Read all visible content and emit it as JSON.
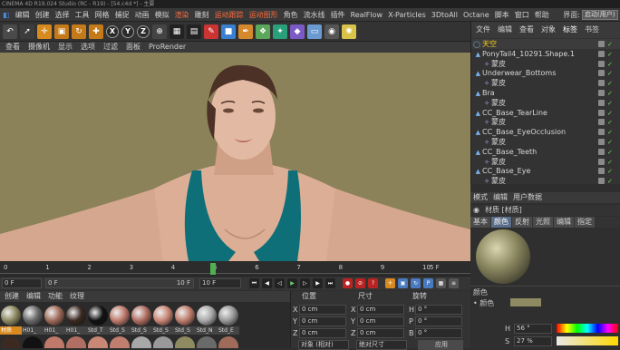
{
  "window": {
    "title": "CINEMA 4D R19.024 Studio (RC - R19) - [54.c4d *] - 主要"
  },
  "menubar": {
    "items": [
      "编辑",
      "创建",
      "选择",
      "工具",
      "网格",
      "捕捉",
      "动画",
      "模拟",
      "渲染",
      "雕刻",
      "运动跟踪",
      "运动图形",
      "角色",
      "流水线",
      "插件",
      "RealFlow",
      "X-Particles",
      "3DtoAll",
      "Octane",
      "脚本",
      "窗口",
      "帮助"
    ],
    "layout_label": "界面:",
    "layout_value": "启动(用户)"
  },
  "toolbar": {
    "axes": [
      "X",
      "Y",
      "Z"
    ]
  },
  "viewport_menu": {
    "items": [
      "查看",
      "摄像机",
      "显示",
      "选项",
      "过滤",
      "面板",
      "ProRender"
    ]
  },
  "timeline": {
    "ticks": [
      "0",
      "1",
      "2",
      "3",
      "4",
      "5",
      "6",
      "7",
      "8",
      "9",
      "10"
    ],
    "current_frame": 5,
    "end_label": "5 F"
  },
  "transport": {
    "start_field": "0 F",
    "range_start": "0 F",
    "range_end": "10 F",
    "end_field": "10 F"
  },
  "material_manager": {
    "menu": [
      "创建",
      "编辑",
      "功能",
      "纹理"
    ],
    "materials": [
      "材质",
      "H01_",
      "H01_",
      "H01_",
      "Std_T",
      "Std_S",
      "Std_S",
      "Std_S",
      "Std_S",
      "Std_N",
      "Std_E"
    ]
  },
  "coordinates": {
    "headers": [
      "位置",
      "尺寸",
      "旋转"
    ],
    "rows": [
      {
        "axis": "X",
        "pos": "0 cm",
        "size_axis": "X",
        "size": "0 cm",
        "rot_axis": "H",
        "rot": "0 °"
      },
      {
        "axis": "Y",
        "pos": "0 cm",
        "size_axis": "Y",
        "size": "0 cm",
        "rot_axis": "P",
        "rot": "0 °"
      },
      {
        "axis": "Z",
        "pos": "0 cm",
        "size_axis": "Z",
        "size": "0 cm",
        "rot_axis": "B",
        "rot": "0 °"
      }
    ],
    "mode_object": "对象 (相对)",
    "mode_size": "绝对尺寸",
    "apply": "应用"
  },
  "object_manager": {
    "menu": [
      "文件",
      "编辑",
      "查看",
      "对象",
      "标签",
      "书签"
    ],
    "objects": [
      {
        "name": "天空",
        "indent": 0,
        "sky": true
      },
      {
        "name": "PonyTail4_10291.Shape.1",
        "indent": 0
      },
      {
        "name": "蒙皮",
        "indent": 1
      },
      {
        "name": "Underwear_Bottoms",
        "indent": 0
      },
      {
        "name": "蒙皮",
        "indent": 1
      },
      {
        "name": "Bra",
        "indent": 0
      },
      {
        "name": "蒙皮",
        "indent": 1
      },
      {
        "name": "CC_Base_TearLine",
        "indent": 0
      },
      {
        "name": "蒙皮",
        "indent": 1
      },
      {
        "name": "CC_Base_EyeOcclusion",
        "indent": 0
      },
      {
        "name": "蒙皮",
        "indent": 1
      },
      {
        "name": "CC_Base_Teeth",
        "indent": 0
      },
      {
        "name": "蒙皮",
        "indent": 1
      },
      {
        "name": "CC_Base_Eye",
        "indent": 0
      },
      {
        "name": "蒙皮",
        "indent": 1
      }
    ]
  },
  "attributes": {
    "tabs": [
      "模式",
      "编辑",
      "用户数据"
    ],
    "material_label": "材质 [材质]",
    "subtabs": [
      "基本",
      "颜色",
      "反射",
      "光照",
      "编辑",
      "指定"
    ],
    "active_subtab": "颜色",
    "section": "颜色",
    "color_label": "颜色",
    "h_label": "H",
    "h_value": "56 °",
    "s_label": "S",
    "s_value": "27 %",
    "color_hex": "#8e8a62"
  },
  "colors": {
    "viewport_bg": "#8c8259",
    "accent_active": "#5a6e8a",
    "sky_label": "#ffd11a"
  }
}
